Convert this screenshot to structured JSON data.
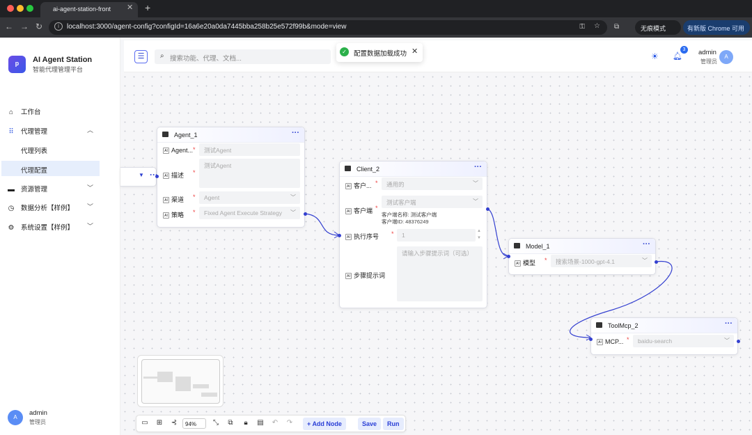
{
  "browser": {
    "tab_title": "ai-agent-station-front",
    "url": "localhost:3000/agent-config?configId=16a6e20a0da7445bba258b25e572f99b&mode=view",
    "incognito": "无痕模式",
    "update": "有新版 Chrome 可用"
  },
  "app": {
    "title": "AI Agent Station",
    "subtitle": "智能代理管理平台"
  },
  "sidebar": {
    "items": [
      {
        "label": "工作台",
        "icon": "home-icon"
      },
      {
        "label": "代理管理",
        "icon": "grid-icon"
      },
      {
        "label": "代理列表"
      },
      {
        "label": "代理配置"
      },
      {
        "label": "资源管理",
        "icon": "folder-icon"
      },
      {
        "label": "数据分析【样例】",
        "icon": "clock-icon"
      },
      {
        "label": "系统设置【样例】",
        "icon": "gear-icon"
      }
    ],
    "user": {
      "name": "admin",
      "role": "管理员",
      "avatar": "A"
    }
  },
  "header": {
    "search_placeholder": "搜索功能、代理、文档...",
    "toast": "配置数据加载成功",
    "badge": "3",
    "user": "admin",
    "role": "管理员",
    "avatar": "A"
  },
  "nodes": {
    "agent": {
      "title": "Agent_1",
      "f1_label": "Agent...",
      "f1_value": "测试Agent",
      "f2_label": "描述",
      "f2_value": "测试Agent",
      "f3_label": "渠道",
      "f3_value": "Agent",
      "f4_label": "策略",
      "f4_value": "Fixed Agent Execute Strategy"
    },
    "client": {
      "title": "Client_2",
      "f1_label": "客户...",
      "f1_value": "通用的",
      "f2_label": "客户端",
      "f2_value": "测试客户端",
      "f2_info1": "客户端名称: 测试客户端",
      "f2_info2": "客户端ID: 48376249",
      "f3_label": "执行序号",
      "f3_value": "1",
      "f4_label": "步骤提示词",
      "f4_placeholder": "请输入步骤提示词（可选）"
    },
    "model": {
      "title": "Model_1",
      "f1_label": "模型",
      "f1_value": "搜索场景-1000-gpt-4.1"
    },
    "tool": {
      "title": "ToolMcp_2",
      "f1_label": "MCP...",
      "f1_value": "baidu-search"
    }
  },
  "toolbar": {
    "zoom": "94%",
    "add_node": "Add Node",
    "save": "Save",
    "run": "Run"
  }
}
